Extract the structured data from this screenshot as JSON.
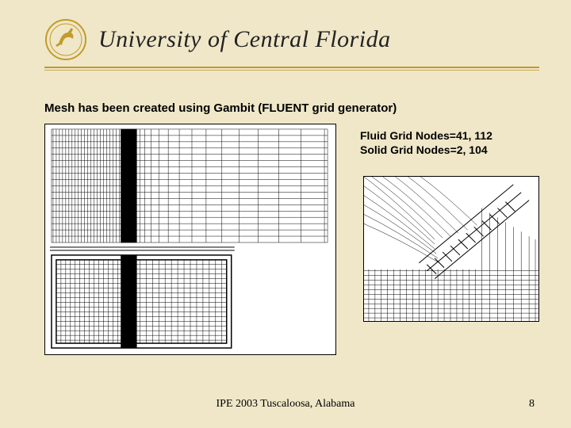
{
  "header": {
    "university": "University of Central Florida",
    "logo_name": "ucf-pegasus-logo"
  },
  "main": {
    "caption": "Mesh has been created using Gambit (FLUENT grid generator)",
    "node_info": {
      "fluid": "Fluid Grid Nodes=41, 112",
      "solid": "Solid Grid Nodes=2, 104"
    },
    "mesh_left_alt": "gambit-mesh-full-view",
    "mesh_right_alt": "gambit-mesh-zoom-view"
  },
  "footer": {
    "conference": "IPE 2003 Tuscaloosa, Alabama",
    "page": "8"
  }
}
